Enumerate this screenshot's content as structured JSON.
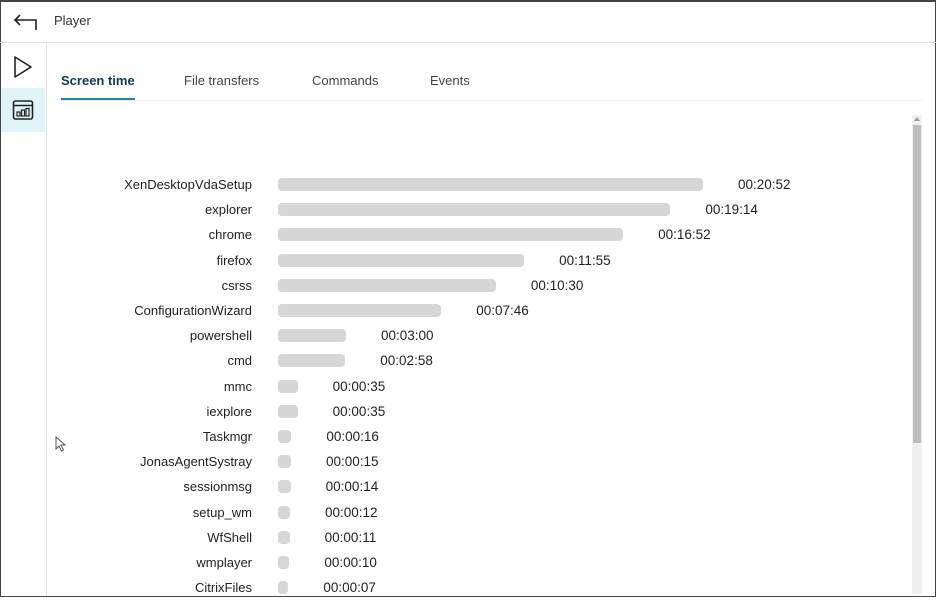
{
  "header": {
    "title": "Player",
    "back_icon": "back-arrow-icon"
  },
  "sidebar": {
    "items": [
      {
        "icon": "play-icon"
      },
      {
        "icon": "dashboard-chart-icon",
        "active": true
      }
    ]
  },
  "tabs": [
    {
      "label": "Screen time",
      "active": true
    },
    {
      "label": "File transfers"
    },
    {
      "label": "Commands"
    },
    {
      "label": "Events"
    }
  ],
  "chart_data": {
    "type": "bar",
    "orientation": "horizontal",
    "categories": [
      "XenDesktopVdaSetup",
      "explorer",
      "chrome",
      "firefox",
      "csrss",
      "ConfigurationWizard",
      "powershell",
      "cmd",
      "mmc",
      "iexplore",
      "Taskmgr",
      "JonasAgentSystray",
      "sessionmsg",
      "setup_wm",
      "WfShell",
      "wmplayer",
      "CitrixFiles"
    ],
    "labels": [
      "00:20:52",
      "00:19:14",
      "00:16:52",
      "00:11:55",
      "00:10:30",
      "00:07:46",
      "00:03:00",
      "00:02:58",
      "00:00:35",
      "00:00:35",
      "00:00:16",
      "00:00:15",
      "00:00:14",
      "00:00:12",
      "00:00:11",
      "00:00:10",
      "00:00:07"
    ],
    "values": [
      1252,
      1154,
      1012,
      715,
      630,
      466,
      180,
      178,
      35,
      35,
      16,
      15,
      14,
      12,
      11,
      10,
      7
    ],
    "unit": "seconds",
    "bar_color": "#d6d6d6"
  },
  "colors": {
    "accent": "#2b7f9e",
    "active_sidebar": "#dff5f7"
  }
}
